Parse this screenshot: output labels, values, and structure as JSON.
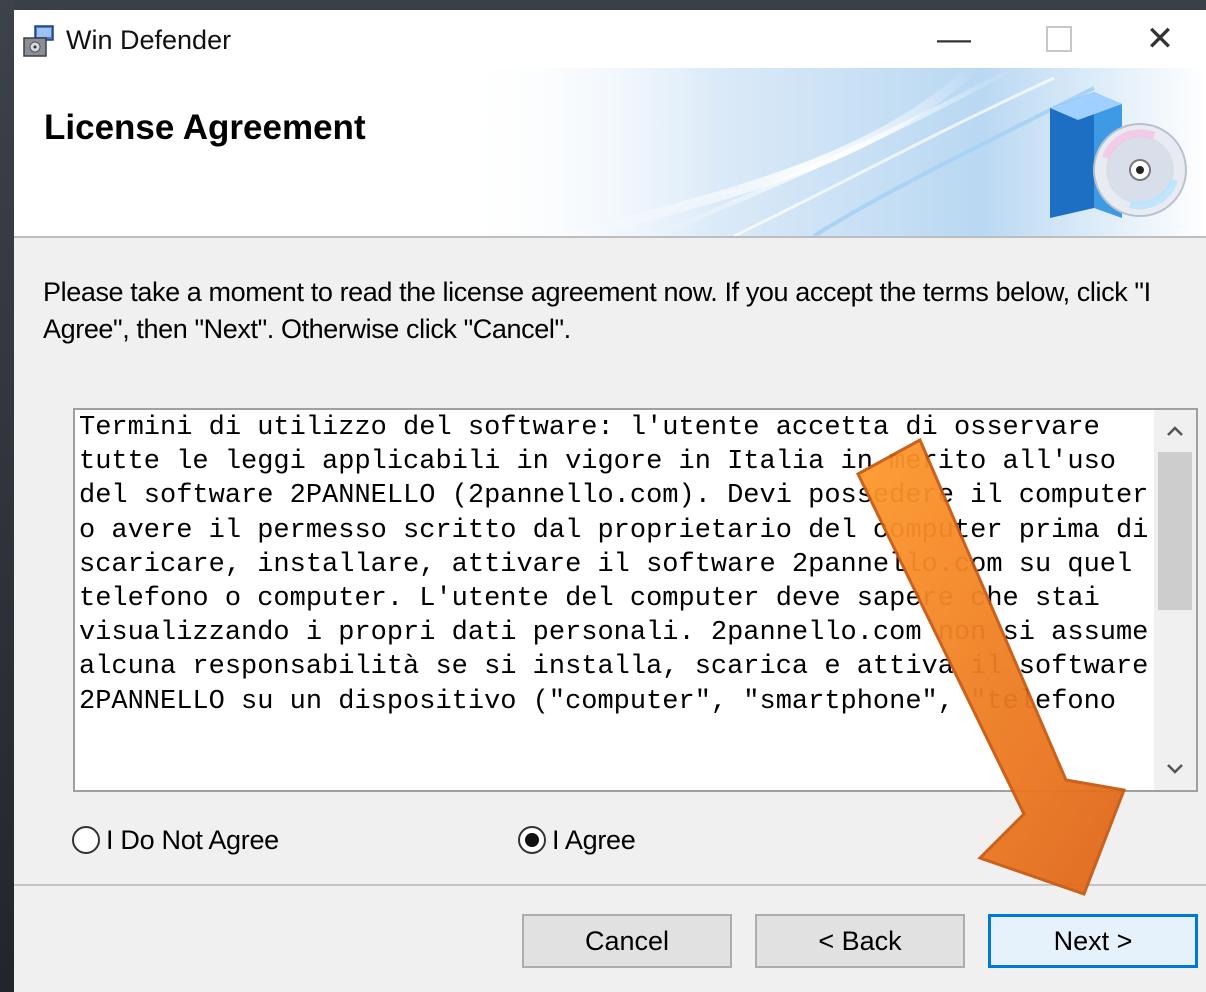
{
  "window": {
    "title": "Win Defender",
    "controls": {
      "minimize": "—",
      "close": "✕"
    }
  },
  "banner": {
    "title": "License Agreement"
  },
  "instructions": "Please take a moment to read the license agreement now. If you accept the terms below, click \"I Agree\", then \"Next\". Otherwise click \"Cancel\".",
  "license": {
    "text": "Termini di utilizzo del software: l'utente accetta di osservare tutte le leggi applicabili in vigore in Italia in merito all'uso del software 2PANNELLO (2pannello.com). Devi possedere il computer o avere il permesso scritto dal proprietario del computer prima di scaricare, installare, attivare il software 2pannello.com su quel telefono o computer. L'utente del computer deve sapere che stai visualizzando i propri dati personali. 2pannello.com non si assume alcuna responsabilità se si installa, scarica e attiva il software 2PANNELLO su un dispositivo (\"computer\", \"smartphone\", \"telefono"
  },
  "options": {
    "not_agree": "I Do Not Agree",
    "agree": "I Agree",
    "selected": "agree"
  },
  "buttons": {
    "cancel": "Cancel",
    "back": "< Back",
    "next": "Next >"
  },
  "colors": {
    "accent": "#0078d7",
    "arrow": "#f07a1a"
  }
}
